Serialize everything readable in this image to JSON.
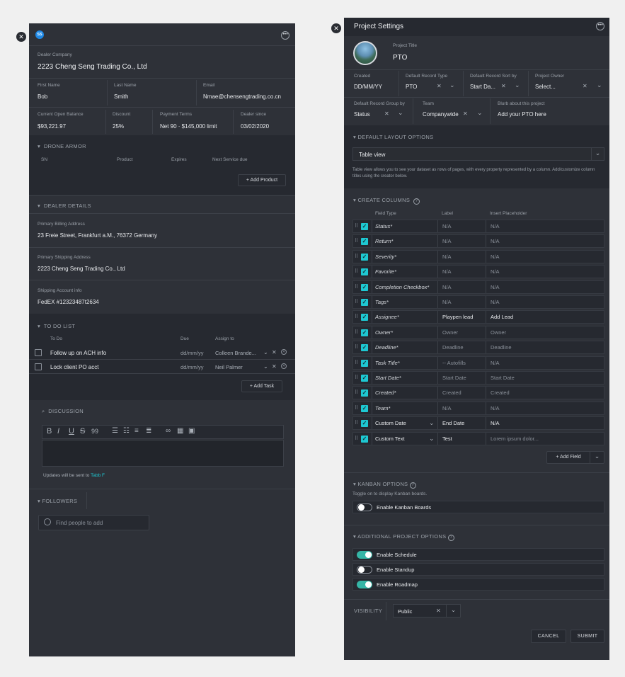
{
  "left": {
    "avatar_initials": "SS",
    "dealer_company_label": "Dealer Company",
    "dealer_company": "2223 Cheng Seng Trading Co., Ltd",
    "first_name_label": "First Name",
    "first_name": "Bob",
    "last_name_label": "Last Name",
    "last_name": "Smith",
    "email_label": "Email",
    "email": "Nmae@chensengtrading.co.cn",
    "balance_label": "Current Open Balance",
    "balance": "$93,221.97",
    "discount_label": "Discount",
    "discount": "25%",
    "terms_label": "Payment Terms",
    "terms": "Net 90 · $145,000 limit",
    "dealer_since_label": "Dealer since",
    "dealer_since": "03/02/2020",
    "drone_armor": {
      "title": "DRONE ARMOR",
      "cols": [
        "SN",
        "Product",
        "Expires",
        "Next Service due"
      ],
      "add_button": "+ Add Product"
    },
    "dealer_details": {
      "title": "DEALER DETAILS",
      "billing_label": "Primary Billing Address",
      "billing": "23 Freie Street, Frankfurt a.M., 76372 Germany",
      "shipping_label": "Primary Shipping Address",
      "shipping": "2223 Cheng Seng Trading Co., Ltd",
      "account_label": "Shipping Account info",
      "account": "FedEX #12323487t2634"
    },
    "todo": {
      "title": "TO DO LIST",
      "col_todo": "To Do",
      "col_due": "Due",
      "col_assign": "Assign to",
      "items": [
        {
          "task": "Follow up on ACH info",
          "due": "dd/mm/yy",
          "assignee": "Colleen Brande..."
        },
        {
          "task": "Lock client PO acct",
          "due": "dd/mm/yy",
          "assignee": "Neil Palmer"
        }
      ],
      "add_button": "+ Add Task"
    },
    "discussion": {
      "title": "DISCUSSION",
      "toolbar": [
        "B",
        "I",
        "U",
        "S",
        "99"
      ],
      "updates_prefix": "Updates will be sent to",
      "updates_name": "Tabb F"
    },
    "followers": {
      "title": "FOLLOWERS",
      "placeholder": "Find people to add"
    }
  },
  "right": {
    "title": "Project Settings",
    "project_title_label": "Project Title",
    "project_title": "PTO",
    "created_label": "Created",
    "created": "DD/MM/YY",
    "record_type_label": "Default Record Type",
    "record_type": "PTO",
    "record_sort_label": "Default Record Sort by",
    "record_sort": "Start Da...",
    "owner_label": "Project Owner",
    "owner": "Select...",
    "group_by_label": "Default Record Group by",
    "group_by": "Status",
    "team_label": "Team",
    "team": "Companywide",
    "blurb_label": "Blurb about this project",
    "blurb": "Add your PTO here",
    "layout": {
      "title": "DEFAULT LAYOUT OPTIONS",
      "selected": "Table view",
      "help": "Table view allows you to see your dataset as rows of pages, with every property represented by a column. Add/customize column titles using the creator below."
    },
    "columns": {
      "title": "CREATE COLUMNS",
      "head_type": "Field Type",
      "head_label": "Label",
      "head_placeholder": "Insert Placeholder",
      "rows": [
        {
          "type": "Status*",
          "label": "N/A",
          "placeholder": "N/A",
          "italic": true,
          "dropdown": false
        },
        {
          "type": "Return*",
          "label": "N/A",
          "placeholder": "N/A",
          "italic": true,
          "dropdown": false
        },
        {
          "type": "Severity*",
          "label": "N/A",
          "placeholder": "N/A",
          "italic": true,
          "dropdown": false
        },
        {
          "type": "Favorite*",
          "label": "N/A",
          "placeholder": "N/A",
          "italic": true,
          "dropdown": false
        },
        {
          "type": "Completion Checkbox*",
          "label": "N/A",
          "placeholder": "N/A",
          "italic": true,
          "dropdown": false
        },
        {
          "type": "Tags*",
          "label": "N/A",
          "placeholder": "N/A",
          "italic": true,
          "dropdown": false
        },
        {
          "type": "Assignee*",
          "label": "Playpen lead",
          "placeholder": "Add Lead",
          "italic": true,
          "dropdown": false,
          "filled": true
        },
        {
          "type": "Owner*",
          "label": "Owner",
          "placeholder": "Owner",
          "italic": true,
          "dropdown": false
        },
        {
          "type": "Deadline*",
          "label": "Deadline",
          "placeholder": "Deadline",
          "italic": true,
          "dropdown": false
        },
        {
          "type": "Task Title*",
          "label": "-- Autofills",
          "placeholder": "N/A",
          "italic": true,
          "dropdown": false
        },
        {
          "type": "Start Date*",
          "label": "Start Date",
          "placeholder": "Start Date",
          "italic": true,
          "dropdown": false
        },
        {
          "type": "Created*",
          "label": "Created",
          "placeholder": "Created",
          "italic": true,
          "dropdown": false
        },
        {
          "type": "Team*",
          "label": "N/A",
          "placeholder": "N/A",
          "italic": true,
          "dropdown": false
        },
        {
          "type": "Custom Date",
          "label": "End Date",
          "placeholder": "N/A",
          "italic": false,
          "dropdown": true,
          "filled": true
        },
        {
          "type": "Custom Text",
          "label": "Test",
          "placeholder": "Lorem ipsum dolor...",
          "italic": false,
          "dropdown": true,
          "filled": true
        }
      ],
      "add_button": "+ Add Field"
    },
    "kanban": {
      "title": "KANBAN OPTIONS",
      "help": "Toggle on to display Kanban boards.",
      "toggle_label": "Enable Kanban Boards",
      "on": false
    },
    "additional": {
      "title": "ADDITIONAL PROJECT OPTIONS",
      "options": [
        {
          "label": "Enable Schedule",
          "on": true
        },
        {
          "label": "Enable Standup",
          "on": false
        },
        {
          "label": "Enable Roadmap",
          "on": true
        }
      ]
    },
    "visibility_label": "VISIBILITY",
    "visibility": "Public",
    "cancel": "CANCEL",
    "submit": "SUBMIT"
  },
  "colors": {
    "accent": "#1ec8d2",
    "panel": "#2e3138",
    "dark": "#262930"
  }
}
